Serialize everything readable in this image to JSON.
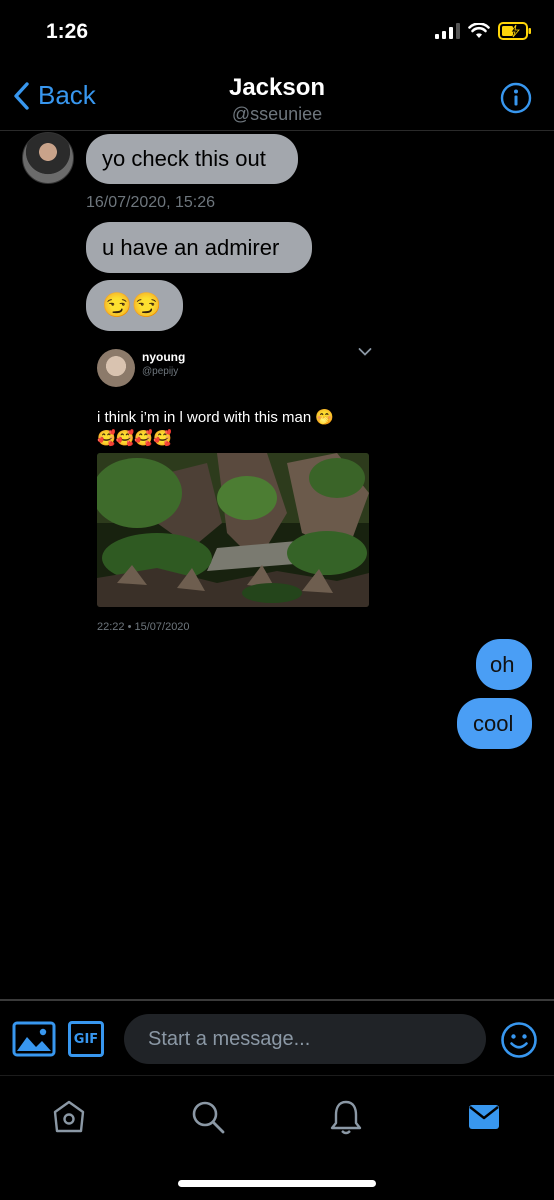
{
  "status_bar": {
    "time": "1:26"
  },
  "header": {
    "back_label": "Back",
    "title": "Jackson",
    "subtitle": "@sseuniee"
  },
  "messages": {
    "m1": "yo check this out",
    "timestamp": "16/07/2020, 15:26",
    "m2": "u have an admirer",
    "m3": "😏😏",
    "out1": "oh",
    "out2": "cool"
  },
  "tweet": {
    "name": "nyoung",
    "handle": "@pepijy",
    "text_line1": "i think i’m in l word with this man 🤭",
    "text_line2": "🥰🥰🥰🥰",
    "date": "22:22 • 15/07/2020"
  },
  "composer": {
    "placeholder": "Start a message...",
    "gif_label": "GIF"
  },
  "colors": {
    "accent": "#3897ef",
    "incoming_bubble": "#a3a7ad",
    "outgoing_bubble": "#4a9ef5",
    "background": "#000000"
  },
  "icons": [
    "back-chevron-icon",
    "info-icon",
    "image-icon",
    "gif-icon",
    "emoji-icon",
    "home-icon",
    "search-icon",
    "bell-icon",
    "mail-icon",
    "chevron-down-icon"
  ]
}
